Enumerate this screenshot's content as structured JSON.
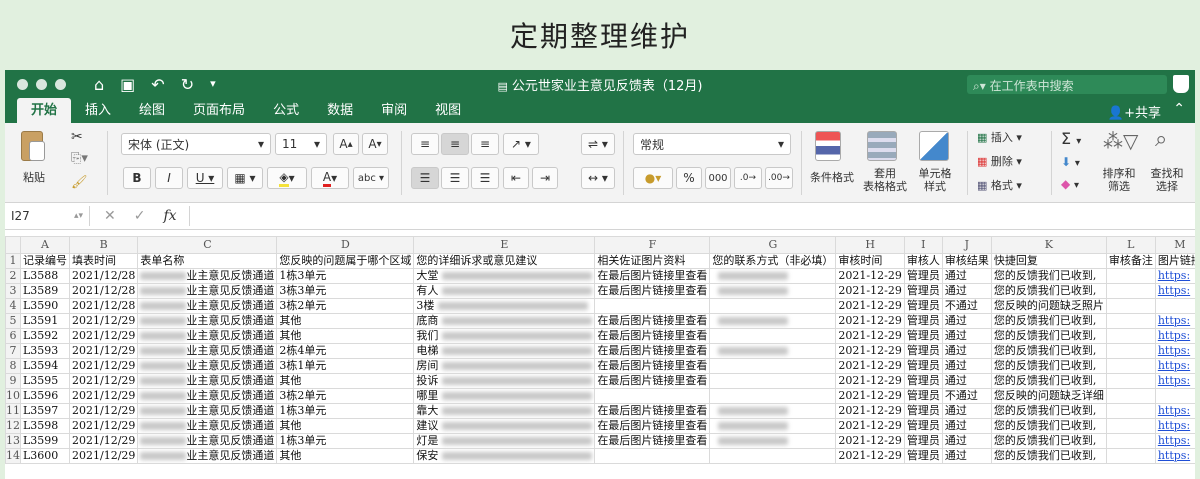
{
  "heading": "定期整理维护",
  "window": {
    "title": "公元世家业主意见反馈表（12月)",
    "search_placeholder": "在工作表中搜索",
    "share_label": "共享"
  },
  "tabs": [
    {
      "label": "开始",
      "active": true
    },
    {
      "label": "插入",
      "active": false
    },
    {
      "label": "绘图",
      "active": false
    },
    {
      "label": "页面布局",
      "active": false
    },
    {
      "label": "公式",
      "active": false
    },
    {
      "label": "数据",
      "active": false
    },
    {
      "label": "审阅",
      "active": false
    },
    {
      "label": "视图",
      "active": false
    }
  ],
  "ribbon": {
    "paste_label": "粘贴",
    "font_name": "宋体 (正文)",
    "font_size": "11",
    "number_format": "常规",
    "percent": "%",
    "thousands": "000",
    "conditional_format": "条件格式",
    "table_format_1": "套用",
    "table_format_2": "表格格式",
    "cell_style_1": "单元格",
    "cell_style_2": "样式",
    "insert_label": "插入",
    "delete_label": "删除",
    "format_label": "格式",
    "sort_filter_1": "排序和",
    "sort_filter_2": "筛选",
    "find_select_1": "查找和",
    "find_select_2": "选择",
    "accent_color": "#217346"
  },
  "formula_bar": {
    "cell_ref": "I27",
    "value": ""
  },
  "columns": [
    "A",
    "B",
    "C",
    "D",
    "E",
    "F",
    "G",
    "H",
    "I",
    "J",
    "K",
    "L",
    "M"
  ],
  "header_row": [
    "记录编号",
    "填表时间",
    "表单名称",
    "您反映的问题属于哪个区域",
    "您的详细诉求或意见建议",
    "相关佐证图片资料",
    "您的联系方式（非必填）",
    "审核时间",
    "审核人",
    "审核结果",
    "快捷回复",
    "审核备注",
    "图片链接"
  ],
  "rows": [
    {
      "n": "2",
      "id": "L3588",
      "date": "2021/12/28",
      "form": "业主意见反馈通道",
      "area": "1栋3单元",
      "detail": "大堂",
      "photo": "在最后图片链接里查看",
      "contact": true,
      "review_time": "2021-12-29",
      "reviewer": "管理员",
      "result": "通过",
      "reply": "您的反馈我们已收到,",
      "link": "https:"
    },
    {
      "n": "3",
      "id": "L3589",
      "date": "2021/12/28",
      "form": "业主意见反馈通道",
      "area": "3栋3单元",
      "detail": "有人",
      "photo": "在最后图片链接里查看",
      "contact": true,
      "review_time": "2021-12-29",
      "reviewer": "管理员",
      "result": "通过",
      "reply": "您的反馈我们已收到,",
      "link": "https:"
    },
    {
      "n": "4",
      "id": "L3590",
      "date": "2021/12/28",
      "form": "业主意见反馈通道",
      "area": "3栋2单元",
      "detail": "3楼",
      "photo": "",
      "contact": false,
      "review_time": "2021-12-29",
      "reviewer": "管理员",
      "result": "不通过",
      "reply": "您反映的问题缺乏照片",
      "link": ""
    },
    {
      "n": "5",
      "id": "L3591",
      "date": "2021/12/29",
      "form": "业主意见反馈通道",
      "area": "其他",
      "detail": "底商",
      "photo": "在最后图片链接里查看",
      "contact": true,
      "review_time": "2021-12-29",
      "reviewer": "管理员",
      "result": "通过",
      "reply": "您的反馈我们已收到,",
      "link": "https:"
    },
    {
      "n": "6",
      "id": "L3592",
      "date": "2021/12/29",
      "form": "业主意见反馈通道",
      "area": "其他",
      "detail": "我们",
      "photo": "在最后图片链接里查看",
      "contact": false,
      "review_time": "2021-12-29",
      "reviewer": "管理员",
      "result": "通过",
      "reply": "您的反馈我们已收到,",
      "link": "https:"
    },
    {
      "n": "7",
      "id": "L3593",
      "date": "2021/12/29",
      "form": "业主意见反馈通道",
      "area": "2栋4单元",
      "detail": "电梯",
      "photo": "在最后图片链接里查看",
      "contact": true,
      "review_time": "2021-12-29",
      "reviewer": "管理员",
      "result": "通过",
      "reply": "您的反馈我们已收到,",
      "link": "https:"
    },
    {
      "n": "8",
      "id": "L3594",
      "date": "2021/12/29",
      "form": "业主意见反馈通道",
      "area": "3栋1单元",
      "detail": "房间",
      "photo": "在最后图片链接里查看",
      "contact": false,
      "review_time": "2021-12-29",
      "reviewer": "管理员",
      "result": "通过",
      "reply": "您的反馈我们已收到,",
      "link": "https:"
    },
    {
      "n": "9",
      "id": "L3595",
      "date": "2021/12/29",
      "form": "业主意见反馈通道",
      "area": "其他",
      "detail": "投诉",
      "photo": "在最后图片链接里查看",
      "contact": false,
      "review_time": "2021-12-29",
      "reviewer": "管理员",
      "result": "通过",
      "reply": "您的反馈我们已收到,",
      "link": "https:"
    },
    {
      "n": "10",
      "id": "L3596",
      "date": "2021/12/29",
      "form": "业主意见反馈通道",
      "area": "3栋2单元",
      "detail": "哪里",
      "photo": "",
      "contact": false,
      "review_time": "2021-12-29",
      "reviewer": "管理员",
      "result": "不通过",
      "reply": "您反映的问题缺乏详细",
      "link": ""
    },
    {
      "n": "11",
      "id": "L3597",
      "date": "2021/12/29",
      "form": "业主意见反馈通道",
      "area": "1栋3单元",
      "detail": "靠大",
      "photo": "在最后图片链接里查看",
      "contact": true,
      "review_time": "2021-12-29",
      "reviewer": "管理员",
      "result": "通过",
      "reply": "您的反馈我们已收到,",
      "link": "https:"
    },
    {
      "n": "12",
      "id": "L3598",
      "date": "2021/12/29",
      "form": "业主意见反馈通道",
      "area": "其他",
      "detail": "建议",
      "photo": "在最后图片链接里查看",
      "contact": true,
      "review_time": "2021-12-29",
      "reviewer": "管理员",
      "result": "通过",
      "reply": "您的反馈我们已收到,",
      "link": "https:"
    },
    {
      "n": "13",
      "id": "L3599",
      "date": "2021/12/29",
      "form": "业主意见反馈通道",
      "area": "1栋3单元",
      "detail": "灯是",
      "photo": "在最后图片链接里查看",
      "contact": true,
      "review_time": "2021-12-29",
      "reviewer": "管理员",
      "result": "通过",
      "reply": "您的反馈我们已收到,",
      "link": "https:"
    },
    {
      "n": "14",
      "id": "L3600",
      "date": "2021/12/29",
      "form": "业主意见反馈通道",
      "area": "其他",
      "detail": "保安",
      "photo": "",
      "contact": false,
      "review_time": "2021-12-29",
      "reviewer": "管理员",
      "result": "通过",
      "reply": "您的反馈我们已收到,",
      "link": "https:"
    }
  ]
}
